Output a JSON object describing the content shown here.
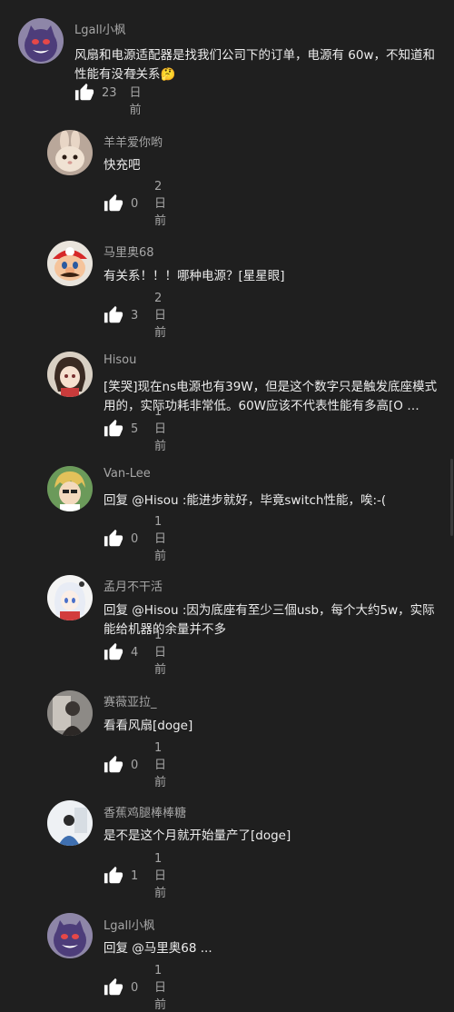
{
  "comments": [
    {
      "username": "Lgall小枫",
      "text": "风扇和电源适配器是找我们公司下的订单，电源有 60w，不知道和性能有没有关系🤔",
      "likes": "23",
      "time": "2日前",
      "avatar": "gengar-avatar"
    },
    {
      "username": "羊羊爱你哟",
      "text": "快充吧",
      "likes": "0",
      "time": "2日前",
      "avatar": "bunny-avatar"
    },
    {
      "username": "马里奥68",
      "text": "有关系！！！哪种电源？[星星眼]",
      "likes": "3",
      "time": "2日前",
      "avatar": "mario-avatar"
    },
    {
      "username": "Hisou",
      "text": "[笑哭]现在ns电源也有39W，但是这个数字只是触发底座模式用的，实际功耗非常低。60W应该不代表性能有多高[O …",
      "likes": "5",
      "time": "1日前",
      "avatar": "anime-girl-avatar"
    },
    {
      "username": "Van-Lee",
      "text": "回复 @Hisou :能进步就好，毕竟switch性能，唉:-(",
      "likes": "0",
      "time": "1日前",
      "avatar": "blonde-avatar"
    },
    {
      "username": "孟月不干活",
      "text": "回复 @Hisou :因为底座有至少三個usb，每个大约5w，实际能给机器的余量并不多",
      "likes": "4",
      "time": "1日前",
      "avatar": "white-hair-avatar"
    },
    {
      "username": "赛薇亚拉_",
      "text": "看看风扇[doge]",
      "likes": "0",
      "time": "1日前",
      "avatar": "photo-avatar"
    },
    {
      "username": "香蕉鸡腿棒棒糖",
      "text": "是不是这个月就开始量产了[doge]",
      "likes": "1",
      "time": "1日前",
      "avatar": "person-avatar"
    },
    {
      "username": "Lgall小枫",
      "text": "回复 @马里奥68 ...",
      "likes": "0",
      "time": "1日前",
      "avatar": "gengar-avatar"
    }
  ],
  "colors": {
    "background": "#1f1f1f",
    "text": "#ededed",
    "secondary": "#a6a6a6"
  },
  "icons": {
    "like": "thumbs-up-icon"
  }
}
